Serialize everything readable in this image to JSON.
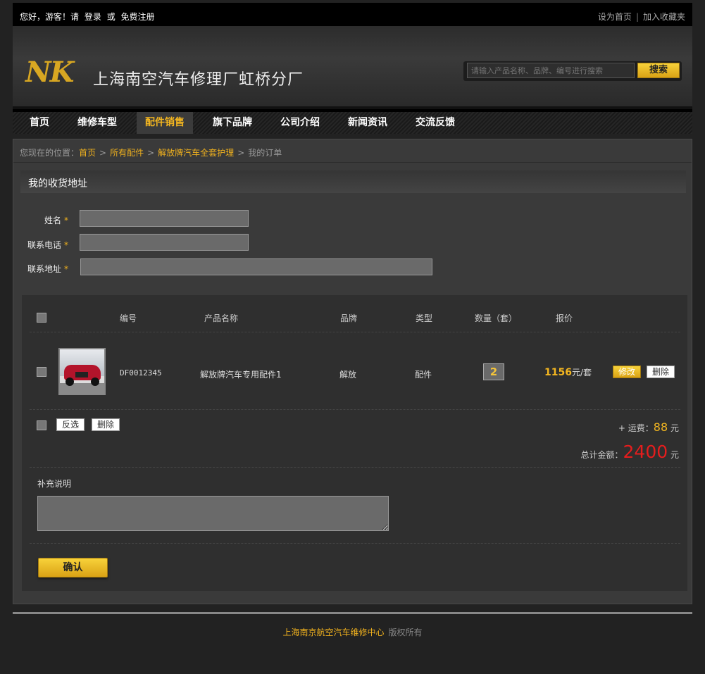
{
  "topbar": {
    "greeting": "您好，游客！请",
    "login": "登录",
    "or": "或",
    "register": "免费注册",
    "set_home": "设为首页",
    "separator": "|",
    "bookmark": "加入收藏夹"
  },
  "header": {
    "logo_mark": "NK",
    "company_name": "上海南空汽车修理厂虹桥分厂",
    "search_placeholder": "请输入产品名称、品牌、编号进行搜索",
    "search_button": "搜索"
  },
  "nav": {
    "items": [
      "首页",
      "维修车型",
      "配件销售",
      "旗下品牌",
      "公司介绍",
      "新闻资讯",
      "交流反馈"
    ],
    "active": "配件销售"
  },
  "breadcrumb": {
    "prefix": "您现在的位置：",
    "links": [
      "首页",
      "所有配件",
      "解放牌汽车全套护理"
    ],
    "current": "我的订单",
    "separator": ">"
  },
  "address": {
    "title": "我的收货地址",
    "name_label": "姓名",
    "phone_label": "联系电话",
    "address_label": "联系地址",
    "required_mark": "*"
  },
  "order": {
    "columns": [
      "编号",
      "产品名称",
      "品牌",
      "类型",
      "数量（套）",
      "报价"
    ],
    "rows": [
      {
        "code": "DF0012345",
        "name": "解放牌汽车专用配件1",
        "brand": "解放",
        "type": "配件",
        "quantity": "2",
        "price": "1156",
        "unit": "元/套",
        "edit_label": "修改",
        "delete_label": "删除"
      }
    ],
    "invert_select": "反选",
    "delete_selected": "删除",
    "freight_label": "+ 运费：",
    "freight_value": "88",
    "freight_unit": "元",
    "total_label": "总计金额：",
    "total_value": "2400",
    "total_unit": "元",
    "note_label": "补充说明",
    "confirm": "确认"
  },
  "footer": {
    "org": "上海南京航空汽车维修中心",
    "rights": "版权所有"
  },
  "colors": {
    "accent": "#f0b11e",
    "total": "#e51d1d",
    "background": "#222222"
  }
}
